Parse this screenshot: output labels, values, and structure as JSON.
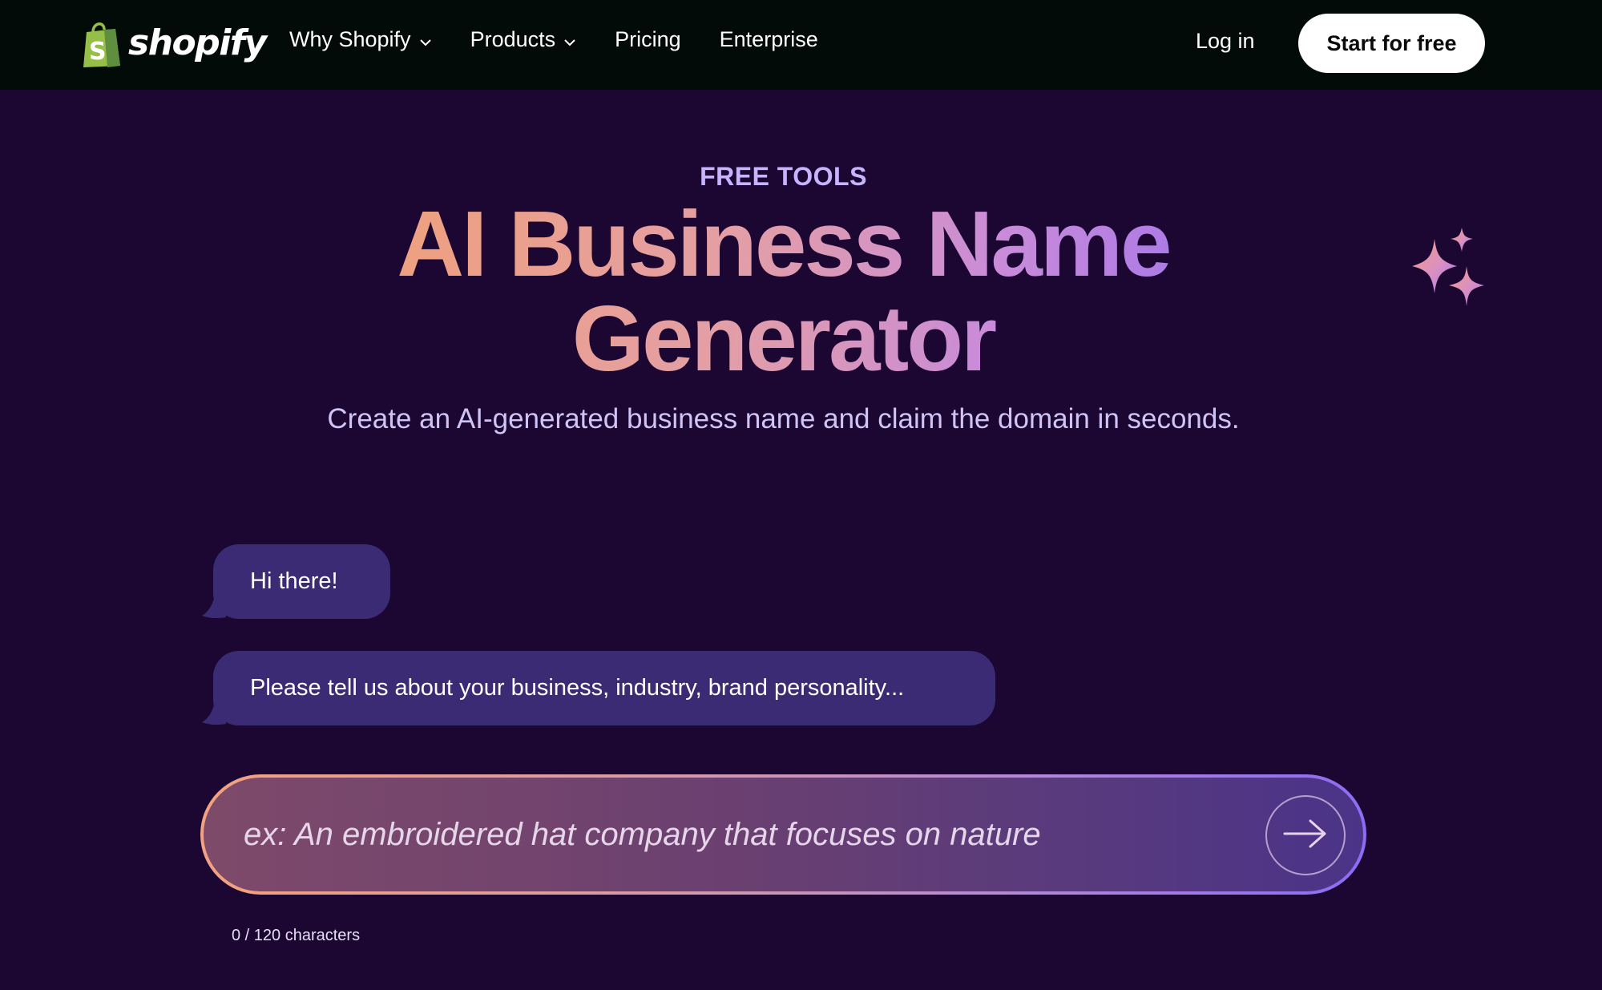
{
  "brand": {
    "wordmark": "shopify",
    "logo_icon": "shopping-bag-icon",
    "logo_color": "#95bf47"
  },
  "nav": {
    "items": [
      {
        "label": "Why Shopify",
        "has_dropdown": true
      },
      {
        "label": "Products",
        "has_dropdown": true
      },
      {
        "label": "Pricing",
        "has_dropdown": false
      },
      {
        "label": "Enterprise",
        "has_dropdown": false
      }
    ],
    "login_label": "Log in",
    "cta_label": "Start for free"
  },
  "hero": {
    "eyebrow": "FREE TOOLS",
    "title_line1": "AI Business Name",
    "title_line2": "Generator",
    "subtitle": "Create an AI-generated business name and claim the domain in seconds.",
    "decoration_icon": "sparkles-icon"
  },
  "chat": {
    "messages": [
      {
        "text": "Hi there!"
      },
      {
        "text": "Please tell us about your business, industry, brand personality..."
      }
    ]
  },
  "prompt": {
    "placeholder": "ex: An embroidered hat company that focuses on nature",
    "value": "",
    "submit_icon": "arrow-right-icon",
    "counter": "0 / 120 characters"
  },
  "colors": {
    "page_bg": "#1b0731",
    "nav_bg": "#030b08",
    "bubble_bg": "#3b2b74",
    "eyebrow": "#c7b4ff",
    "gradient_start": "#f0a07c",
    "gradient_end": "#9d71ee"
  }
}
